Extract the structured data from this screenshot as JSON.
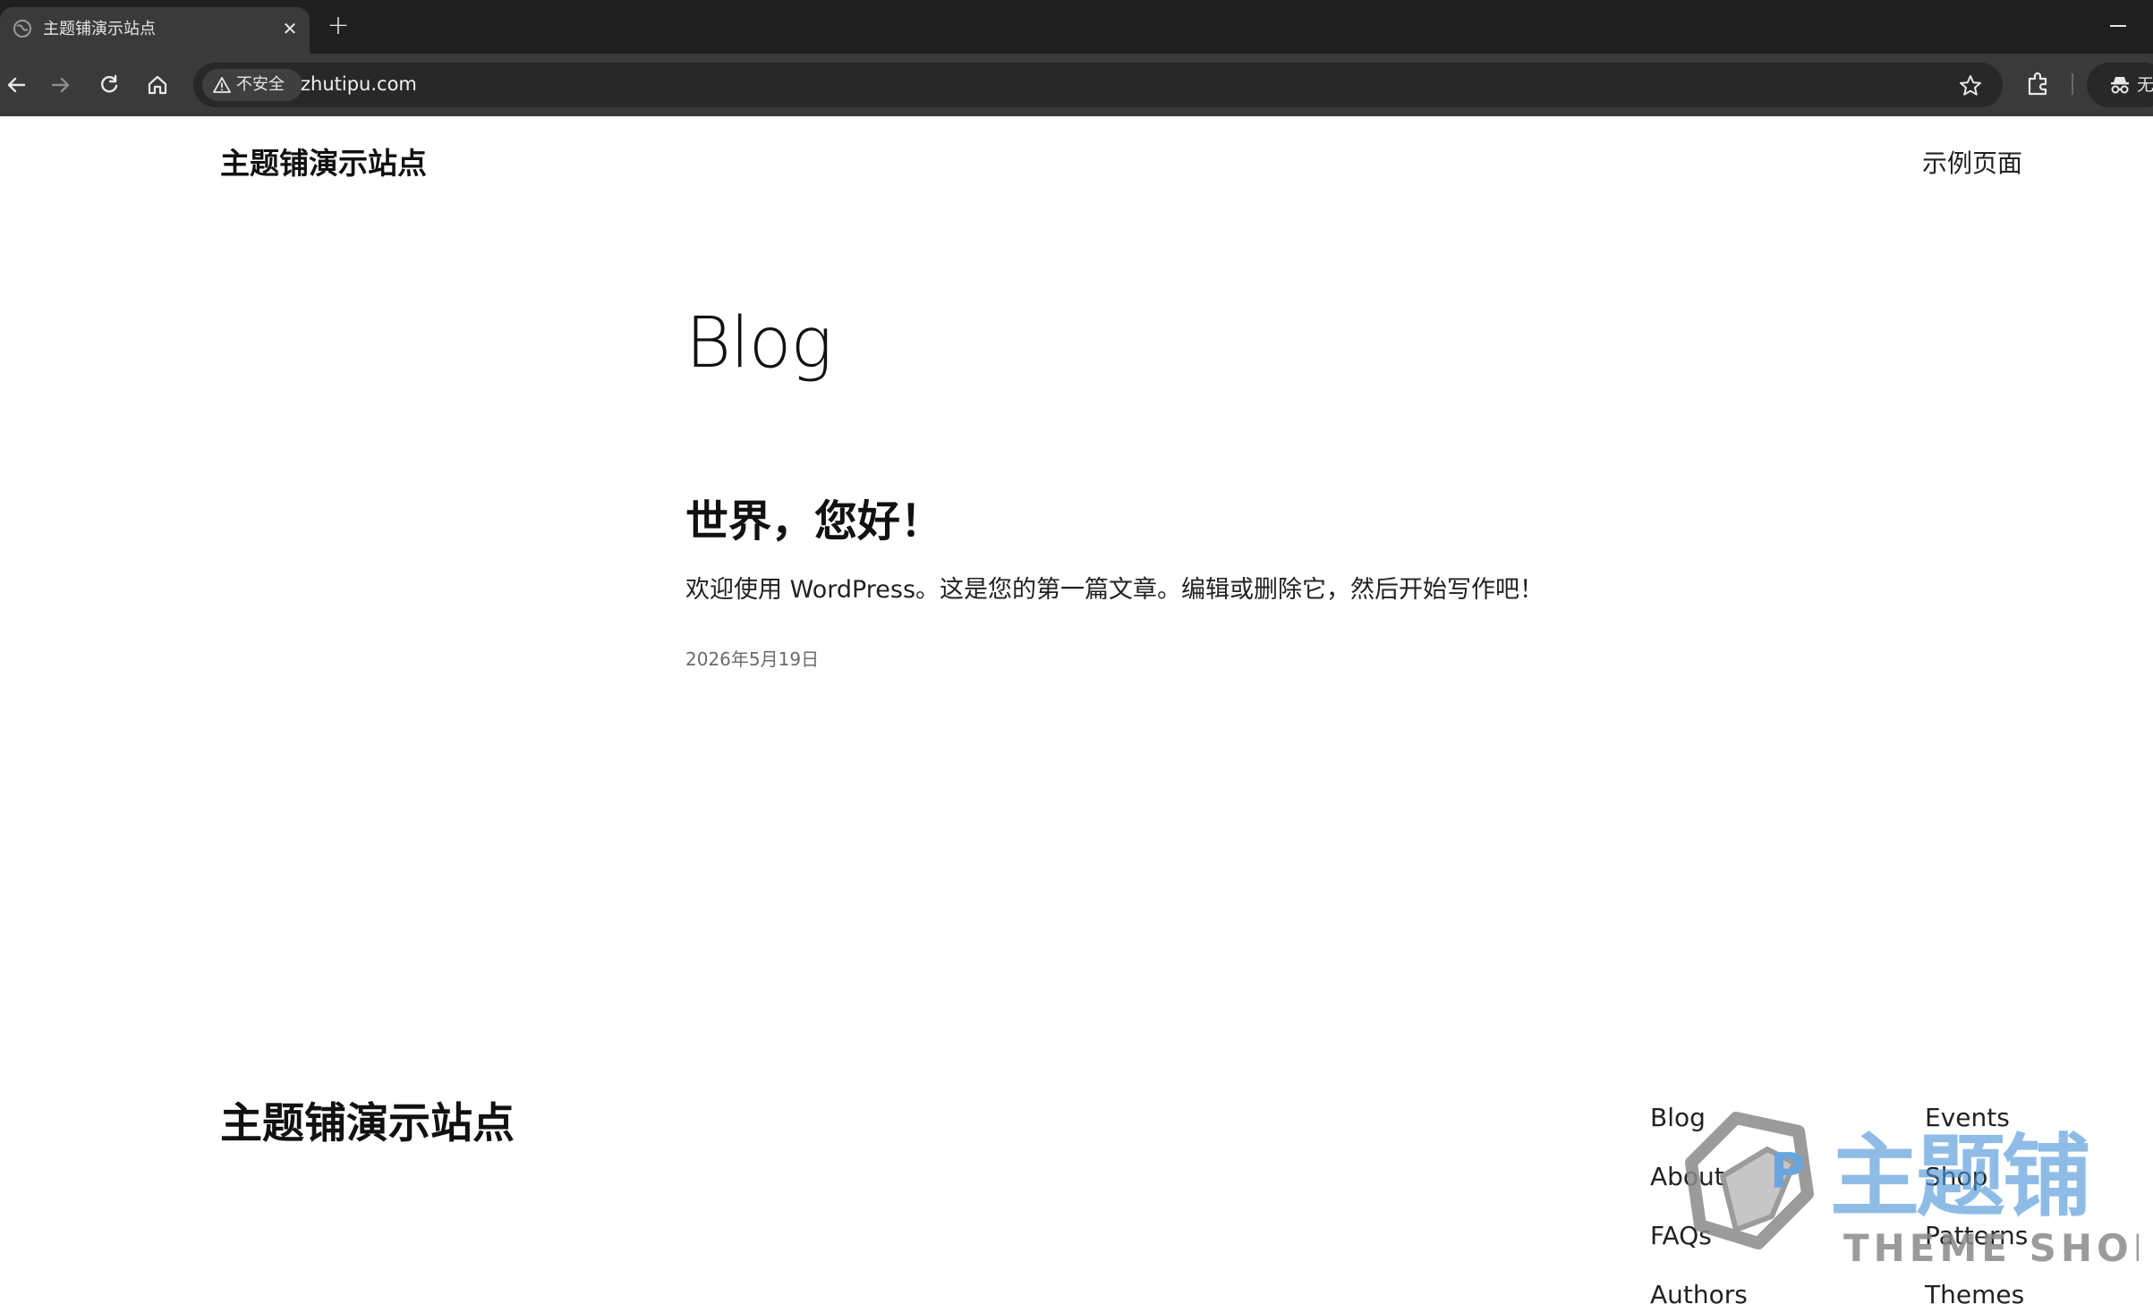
{
  "browser": {
    "tab": {
      "title": "主题铺演示站点",
      "favicon": "globe-icon",
      "close": "✕"
    },
    "new_tab": "+",
    "address": {
      "security_label": "不安全",
      "url": "zhutipu.com"
    },
    "profile_label": "无"
  },
  "site": {
    "title": "主题铺演示站点",
    "nav": {
      "sample_page": "示例页面"
    }
  },
  "main": {
    "heading": "Blog",
    "posts": [
      {
        "title": "世界，您好！",
        "excerpt": "欢迎使用 WordPress。这是您的第一篇文章。编辑或删除它，然后开始写作吧！",
        "date": "2026年5月19日"
      }
    ]
  },
  "footer": {
    "title": "主题铺演示站点",
    "links_col1": [
      "Blog",
      "About",
      "FAQs",
      "Authors"
    ],
    "links_col2": [
      "Events",
      "Shop",
      "Patterns",
      "Themes"
    ]
  },
  "watermark": {
    "brand_cn": "主题铺",
    "brand_en": "THEME SHOP",
    "logo_letter": "P",
    "colors": {
      "blue": "#4f97d8",
      "gray": "#8a8a8a"
    }
  },
  "colors": {
    "chrome_dark": "#1f1f1f",
    "chrome_tab": "#3a3a3a",
    "omnibox": "#282828",
    "page_bg": "#ffffff",
    "date_gray": "#6b6b6b"
  }
}
